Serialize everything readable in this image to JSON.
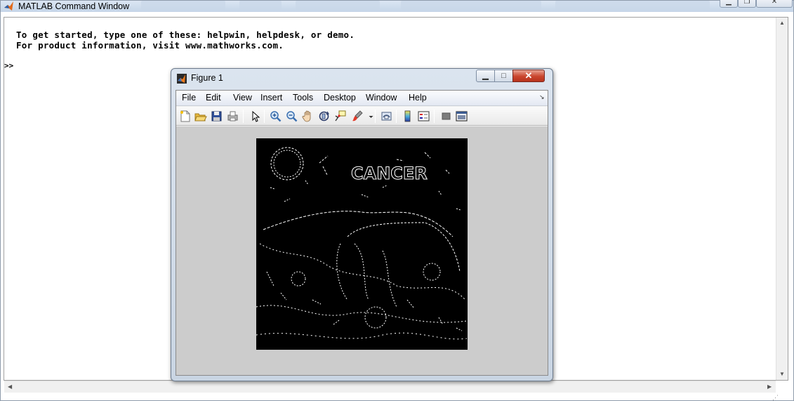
{
  "command_window": {
    "title": "MATLAB Command Window",
    "intro_lines": [
      "To get started, type one of these: helpwin, helpdesk, or demo.",
      "For product information, visit www.mathworks.com."
    ],
    "prompt": ">>"
  },
  "figure": {
    "title": "Figure 1",
    "menus": [
      "File",
      "Edit",
      "View",
      "Insert",
      "Tools",
      "Desktop",
      "Window",
      "Help"
    ],
    "menu_dock_glyph": "↘",
    "toolbar": [
      "new-figure-icon",
      "open-file-icon",
      "save-figure-icon",
      "print-figure-icon",
      "edit-plot-arrow-icon",
      "zoom-in-icon",
      "zoom-out-icon",
      "pan-hand-icon",
      "rotate-3d-icon",
      "data-cursor-icon",
      "brush-icon",
      "link-plot-icon",
      "insert-colorbar-icon",
      "insert-legend-icon",
      "hide-plot-tools-icon",
      "show-plot-tools-icon"
    ],
    "image_text": "CANCER"
  },
  "colors": {
    "title_gradient_top": "#dbe6f3",
    "close_button_red": "#c9452d",
    "axes_background": "#cccccc",
    "image_background": "#000000"
  }
}
